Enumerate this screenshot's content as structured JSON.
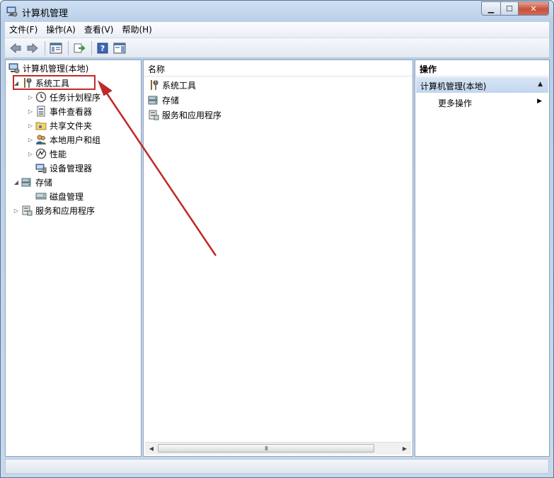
{
  "window": {
    "title": "计算机管理"
  },
  "menu": [
    {
      "label": "文件(F)"
    },
    {
      "label": "操作(A)"
    },
    {
      "label": "查看(V)"
    },
    {
      "label": "帮助(H)"
    }
  ],
  "toolbar": {
    "buttons": [
      "back-icon",
      "forward-icon",
      "console-tree-icon",
      "export-icon",
      "help-icon",
      "show-hide-icon"
    ]
  },
  "tree": {
    "root": "计算机管理(本地)",
    "system_tools": "系统工具",
    "task_scheduler": "任务计划程序",
    "event_viewer": "事件查看器",
    "shared_folders": "共享文件夹",
    "local_users": "本地用户和组",
    "performance": "性能",
    "device_manager": "设备管理器",
    "storage": "存储",
    "disk_management": "磁盘管理",
    "services_apps": "服务和应用程序"
  },
  "center": {
    "column_header": "名称",
    "items": [
      "系统工具",
      "存储",
      "服务和应用程序"
    ],
    "scroll_grip": "III"
  },
  "actions": {
    "header": "操作",
    "section": "计算机管理(本地)",
    "more": "更多操作"
  },
  "colors": {
    "highlight": "#c62828",
    "arrow": "#c0282a"
  }
}
